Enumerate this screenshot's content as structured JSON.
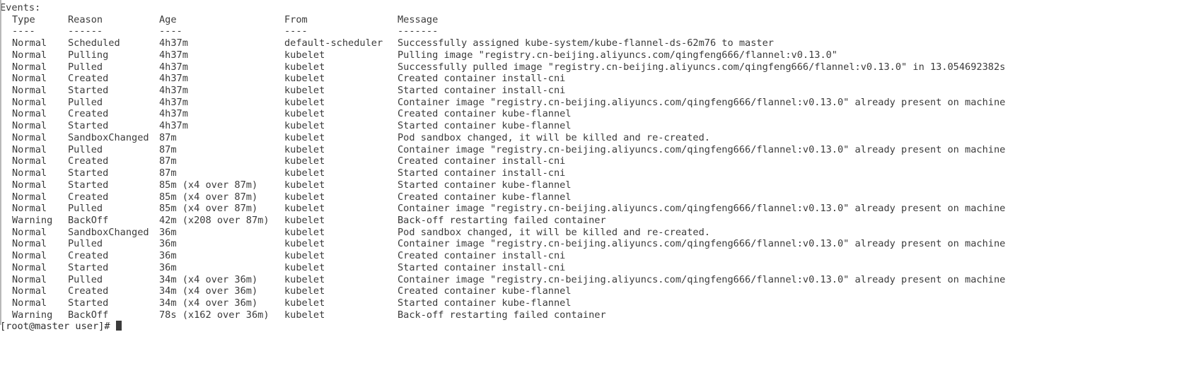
{
  "terminal": {
    "section_label": "Events:",
    "columns": {
      "type": "Type",
      "reason": "Reason",
      "age": "Age",
      "from": "From",
      "message": "Message"
    },
    "column_rules": {
      "type": "----",
      "reason": "------",
      "age": "----",
      "from": "----",
      "message": "-------"
    },
    "colors": {
      "background": "#ffffff",
      "foreground": "#3b3b3b",
      "border": "#b9b9b9",
      "cursor": "#3b3b3b"
    },
    "events": [
      {
        "type": "Normal",
        "reason": "Scheduled",
        "age": "4h37m",
        "from": "default-scheduler",
        "message": "Successfully assigned kube-system/kube-flannel-ds-62m76 to master"
      },
      {
        "type": "Normal",
        "reason": "Pulling",
        "age": "4h37m",
        "from": "kubelet",
        "message": "Pulling image \"registry.cn-beijing.aliyuncs.com/qingfeng666/flannel:v0.13.0\""
      },
      {
        "type": "Normal",
        "reason": "Pulled",
        "age": "4h37m",
        "from": "kubelet",
        "message": "Successfully pulled image \"registry.cn-beijing.aliyuncs.com/qingfeng666/flannel:v0.13.0\" in 13.054692382s"
      },
      {
        "type": "Normal",
        "reason": "Created",
        "age": "4h37m",
        "from": "kubelet",
        "message": "Created container install-cni"
      },
      {
        "type": "Normal",
        "reason": "Started",
        "age": "4h37m",
        "from": "kubelet",
        "message": "Started container install-cni"
      },
      {
        "type": "Normal",
        "reason": "Pulled",
        "age": "4h37m",
        "from": "kubelet",
        "message": "Container image \"registry.cn-beijing.aliyuncs.com/qingfeng666/flannel:v0.13.0\" already present on machine"
      },
      {
        "type": "Normal",
        "reason": "Created",
        "age": "4h37m",
        "from": "kubelet",
        "message": "Created container kube-flannel"
      },
      {
        "type": "Normal",
        "reason": "Started",
        "age": "4h37m",
        "from": "kubelet",
        "message": "Started container kube-flannel"
      },
      {
        "type": "Normal",
        "reason": "SandboxChanged",
        "age": "87m",
        "from": "kubelet",
        "message": "Pod sandbox changed, it will be killed and re-created."
      },
      {
        "type": "Normal",
        "reason": "Pulled",
        "age": "87m",
        "from": "kubelet",
        "message": "Container image \"registry.cn-beijing.aliyuncs.com/qingfeng666/flannel:v0.13.0\" already present on machine"
      },
      {
        "type": "Normal",
        "reason": "Created",
        "age": "87m",
        "from": "kubelet",
        "message": "Created container install-cni"
      },
      {
        "type": "Normal",
        "reason": "Started",
        "age": "87m",
        "from": "kubelet",
        "message": "Started container install-cni"
      },
      {
        "type": "Normal",
        "reason": "Started",
        "age": "85m (x4 over 87m)",
        "from": "kubelet",
        "message": "Started container kube-flannel"
      },
      {
        "type": "Normal",
        "reason": "Created",
        "age": "85m (x4 over 87m)",
        "from": "kubelet",
        "message": "Created container kube-flannel"
      },
      {
        "type": "Normal",
        "reason": "Pulled",
        "age": "85m (x4 over 87m)",
        "from": "kubelet",
        "message": "Container image \"registry.cn-beijing.aliyuncs.com/qingfeng666/flannel:v0.13.0\" already present on machine"
      },
      {
        "type": "Warning",
        "reason": "BackOff",
        "age": "42m (x208 over 87m)",
        "from": "kubelet",
        "message": "Back-off restarting failed container"
      },
      {
        "type": "Normal",
        "reason": "SandboxChanged",
        "age": "36m",
        "from": "kubelet",
        "message": "Pod sandbox changed, it will be killed and re-created."
      },
      {
        "type": "Normal",
        "reason": "Pulled",
        "age": "36m",
        "from": "kubelet",
        "message": "Container image \"registry.cn-beijing.aliyuncs.com/qingfeng666/flannel:v0.13.0\" already present on machine"
      },
      {
        "type": "Normal",
        "reason": "Created",
        "age": "36m",
        "from": "kubelet",
        "message": "Created container install-cni"
      },
      {
        "type": "Normal",
        "reason": "Started",
        "age": "36m",
        "from": "kubelet",
        "message": "Started container install-cni"
      },
      {
        "type": "Normal",
        "reason": "Pulled",
        "age": "34m (x4 over 36m)",
        "from": "kubelet",
        "message": "Container image \"registry.cn-beijing.aliyuncs.com/qingfeng666/flannel:v0.13.0\" already present on machine"
      },
      {
        "type": "Normal",
        "reason": "Created",
        "age": "34m (x4 over 36m)",
        "from": "kubelet",
        "message": "Created container kube-flannel"
      },
      {
        "type": "Normal",
        "reason": "Started",
        "age": "34m (x4 over 36m)",
        "from": "kubelet",
        "message": "Started container kube-flannel"
      },
      {
        "type": "Warning",
        "reason": "BackOff",
        "age": "78s (x162 over 36m)",
        "from": "kubelet",
        "message": "Back-off restarting failed container"
      }
    ],
    "prompt": {
      "text": "[root@master user]# ",
      "cursor": "block"
    }
  }
}
